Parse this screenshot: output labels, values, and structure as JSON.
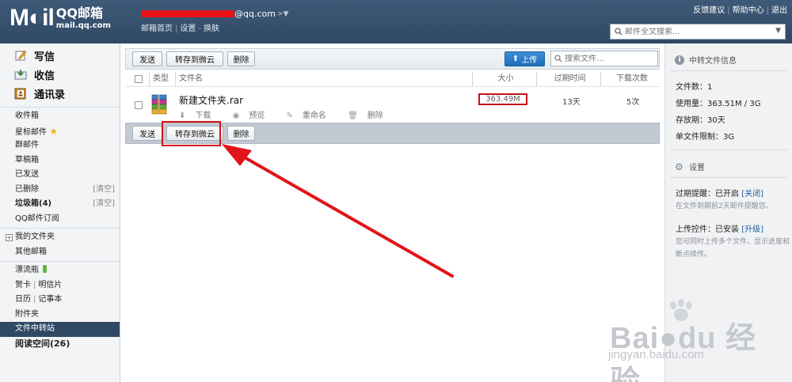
{
  "header": {
    "logo_main": "M◐il",
    "logo_cn": "QQ邮箱",
    "logo_domain": "mail.qq.com",
    "account_suffix": "@qq.com",
    "account_arrow": ">▼",
    "links": [
      "邮箱首页",
      "设置",
      "换肤"
    ],
    "top_right": [
      "反馈建议",
      "帮助中心",
      "退出"
    ],
    "search_placeholder": "邮件全文搜索..."
  },
  "sidebar": {
    "actions": [
      {
        "label": "写信",
        "icon": "pencil-icon"
      },
      {
        "label": "收信",
        "icon": "inbox-receive-icon"
      },
      {
        "label": "通讯录",
        "icon": "address-book-icon"
      }
    ],
    "folders": [
      {
        "label": "收件箱"
      },
      {
        "label": "星标邮件"
      },
      {
        "label": "群邮件"
      },
      {
        "label": "草稿箱"
      },
      {
        "label": "已发送"
      },
      {
        "label": "已删除",
        "right": "[清空]"
      },
      {
        "label": "垃圾箱(4)",
        "right": "[清空]"
      },
      {
        "label": "QQ邮件订阅"
      }
    ],
    "my_folders": "我的文件夹",
    "other_mail": "其他邮箱",
    "drift_bottle": "漂流瓶",
    "card": "贺卡",
    "postcard": "明信片",
    "calendar": "日历",
    "notebook": "记事本",
    "attachments": "附件夹",
    "file_transfer": "文件中转站",
    "reading_space": "阅读空间(26)"
  },
  "toolbar": {
    "send": "发送",
    "save_to_cloud": "转存到微云",
    "delete": "删除",
    "upload": "上传",
    "search_placeholder": "搜索文件..."
  },
  "table": {
    "headers": {
      "type": "类型",
      "name": "文件名",
      "size": "大小",
      "expire": "过期时间",
      "downloads": "下载次数"
    },
    "rows": [
      {
        "name": "新建文件夹.rar",
        "size": "363.49M",
        "expire": "13天",
        "downloads": "5次",
        "actions": [
          "下载",
          "预览",
          "重命名",
          "删除"
        ]
      }
    ]
  },
  "right_panel": {
    "info_title": "中转文件信息",
    "file_count": "文件数：1",
    "usage": "使用量：363.51M / 3G",
    "retention": "存放期：30天",
    "single_limit": "单文件限制：3G",
    "settings_title": "设置",
    "expire_reminder_label": "过期提醒：已开启",
    "expire_reminder_link": "[关闭]",
    "expire_reminder_note": "在文件到期前2天邮件提醒您。",
    "upload_plugin_label": "上传控件：已安装",
    "upload_plugin_link": "[升级]",
    "upload_plugin_note": "您可同时上传多个文件、显示进度和断点续传。"
  },
  "watermark": {
    "brand": "Bai●du 经验",
    "url": "jingyan.baidu.com"
  },
  "colors": {
    "header_bg": "#34506e",
    "accent_red": "#d1121a",
    "upload_blue": "#2a7fcb",
    "active_item_bg": "#2f4965"
  }
}
